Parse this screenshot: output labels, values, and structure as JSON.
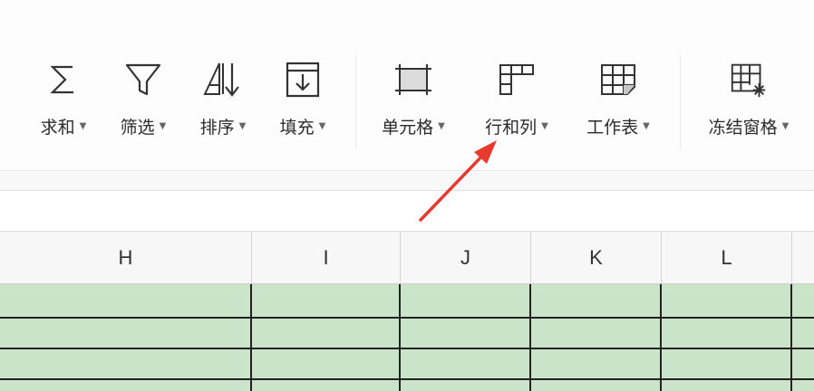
{
  "toolbar": {
    "sum": {
      "label": "求和",
      "icon": "sigma-icon"
    },
    "filter": {
      "label": "筛选",
      "icon": "filter-icon"
    },
    "sort": {
      "label": "排序",
      "icon": "sort-icon"
    },
    "fill": {
      "label": "填充",
      "icon": "fill-icon"
    },
    "cell": {
      "label": "单元格",
      "icon": "cell-icon"
    },
    "rows_cols": {
      "label": "行和列",
      "icon": "rows-columns-icon"
    },
    "worksheet": {
      "label": "工作表",
      "icon": "worksheet-icon"
    },
    "freeze": {
      "label": "冻结窗格",
      "icon": "freeze-panes-icon"
    }
  },
  "columns": [
    "H",
    "I",
    "J",
    "K",
    "L"
  ],
  "colors": {
    "cell_fill": "#c9e4c9",
    "arrow": "#e8392f",
    "grid_line": "#222222"
  }
}
